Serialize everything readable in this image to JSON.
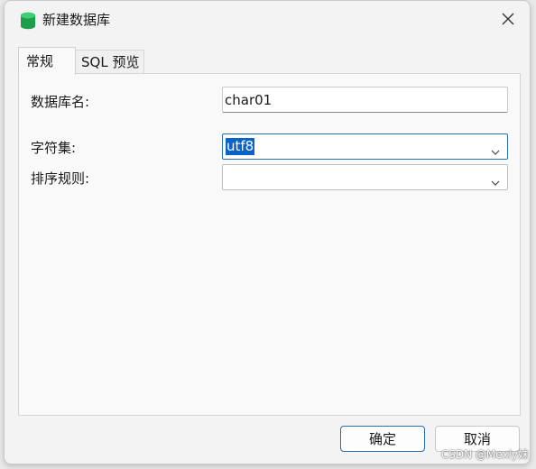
{
  "window": {
    "title": "新建数据库",
    "icon": "database-icon",
    "close_icon": "close-icon"
  },
  "tabs": [
    {
      "label": "常规",
      "active": true
    },
    {
      "label": "SQL 预览",
      "active": false
    }
  ],
  "form": {
    "db_name_label": "数据库名:",
    "db_name_value": "char01",
    "charset_label": "字符集:",
    "charset_value": "utf8",
    "collation_label": "排序规则:",
    "collation_value": ""
  },
  "footer": {
    "ok_label": "确定",
    "cancel_label": "取消"
  },
  "watermark": "CSDN @Mexly妹",
  "colors": {
    "accent": "#2a6fb3",
    "selection": "#0a64c8",
    "db_icon": "#1e9e4a"
  }
}
